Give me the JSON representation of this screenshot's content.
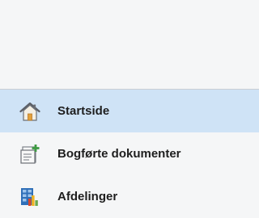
{
  "navigation": {
    "items": [
      {
        "label": "Startside",
        "icon": "home-icon",
        "selected": true
      },
      {
        "label": "Bogførte dokumenter",
        "icon": "posted-documents-icon",
        "selected": false
      },
      {
        "label": "Afdelinger",
        "icon": "departments-icon",
        "selected": false
      }
    ]
  },
  "colors": {
    "background": "#f5f6f7",
    "selected_background": "#cfe3f6",
    "divider": "#c9ced4",
    "text": "#1e1e1e"
  }
}
